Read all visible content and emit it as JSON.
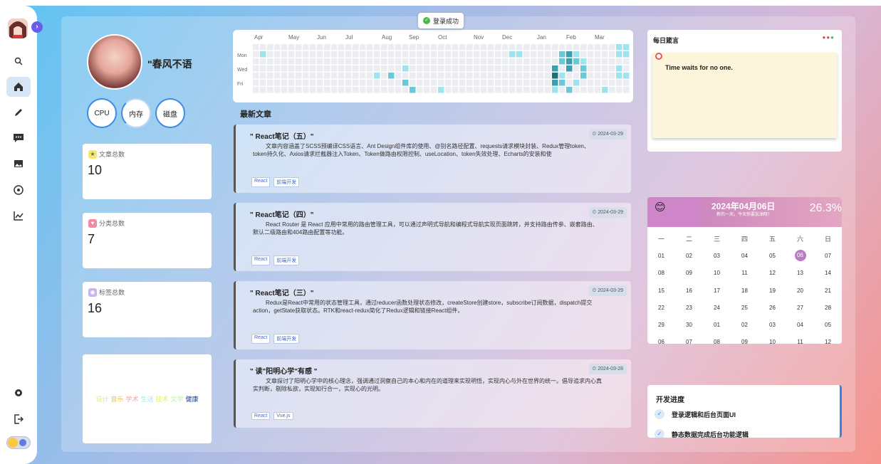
{
  "toast": {
    "text": "登录成功"
  },
  "profile": {
    "name": "\"春风不语",
    "rings": [
      "CPU",
      "内存",
      "磁盘"
    ]
  },
  "stats": [
    {
      "label": "文章总数",
      "value": "10",
      "icon": "star-icon",
      "color": "#f5e86e"
    },
    {
      "label": "分类总数",
      "value": "7",
      "icon": "heart-icon",
      "color": "#f28aa0"
    },
    {
      "label": "标签总数",
      "value": "16",
      "icon": "tag-icon",
      "color": "#c9b2f0"
    }
  ],
  "tags": [
    {
      "text": "设计",
      "color": "#d8f07a"
    },
    {
      "text": "音乐",
      "color": "#e8c44e"
    },
    {
      "text": "学术",
      "color": "#f4a6a6"
    },
    {
      "text": "生活",
      "color": "#a8e4f0"
    },
    {
      "text": "技术",
      "color": "#e4ef63"
    },
    {
      "text": "文学",
      "color": "#c5f0a0"
    },
    {
      "text": "健康",
      "color": "#1f3c8c"
    }
  ],
  "heatmap": {
    "months": [
      "Apr",
      "May",
      "Jun",
      "Jul",
      "Aug",
      "Sep",
      "Oct",
      "Nov",
      "Dec",
      "Jan",
      "Feb",
      "Mar"
    ],
    "days": [
      "Mon",
      "Wed",
      "Fri"
    ]
  },
  "articles_title": "最新文章",
  "articles": [
    {
      "title": "\" React笔记（五）\"",
      "date": "2024-03-29",
      "summary": "文章内容涵盖了SCSS预编译CSS语言、Ant Design组件库的使用、@别名路径配置、requests请求模块封装、Redux管理token、token持久化、Axios请求拦截器注入Token、Token做路由权限控制、useLocation、token失效处理、Echarts的安装和使",
      "tags": [
        "React",
        "前端开发"
      ]
    },
    {
      "title": "\" React笔记（四）\"",
      "date": "2024-03-29",
      "summary": "React Router 是 React 应用中常用的路由管理工具，可以通过声明式导航和编程式导航实现页面跳转，并支持路由传参、嵌套路由、默认二级路由和404路由配置等功能。",
      "tags": [
        "React",
        "前端开发"
      ]
    },
    {
      "title": "\" React笔记（三）\"",
      "date": "2024-03-29",
      "summary": "Redux是React中常用的状态管理工具，通过reducer函数处理状态修改，createStore创建store，subscribe订阅数据，dispatch提交action，getState获取状态。RTK和react-redux简化了Redux逻辑和链接React组件。",
      "tags": [
        "React",
        "前端开发"
      ]
    },
    {
      "title": "\" 读\"阳明心学\"有感 \"",
      "date": "2024-03-28",
      "summary": "文章探讨了阳明心学中的核心理念，强调通过洞察自己的本心和内在的道理来实现明悟，实现内心与外在世界的统一。倡导追求内心真实判断，剔除私欲，实现知行合一，实现心的光明。",
      "tags": [
        "React",
        "Vue.js"
      ]
    }
  ],
  "quote": {
    "title": "每日箴言",
    "text": "Time waits for no one."
  },
  "calendar": {
    "date": "2024年04月06日",
    "sub": "新的一天，今天你要加油呀！",
    "percent": "26.3%",
    "weekdays": [
      "一",
      "二",
      "三",
      "四",
      "五",
      "六",
      "日"
    ],
    "rows": [
      [
        "01",
        "02",
        "03",
        "04",
        "05",
        "06",
        "07"
      ],
      [
        "08",
        "09",
        "10",
        "11",
        "12",
        "13",
        "14"
      ],
      [
        "15",
        "16",
        "17",
        "18",
        "19",
        "20",
        "21"
      ],
      [
        "22",
        "23",
        "24",
        "25",
        "26",
        "27",
        "28"
      ],
      [
        "29",
        "30",
        "01",
        "02",
        "03",
        "04",
        "05"
      ],
      [
        "06",
        "07",
        "08",
        "09",
        "10",
        "11",
        "12"
      ]
    ],
    "today": "06"
  },
  "progress": {
    "title": "开发进度",
    "items": [
      "登录逻辑和后台页面UI",
      "静态数据完成后台功能逻辑"
    ]
  }
}
